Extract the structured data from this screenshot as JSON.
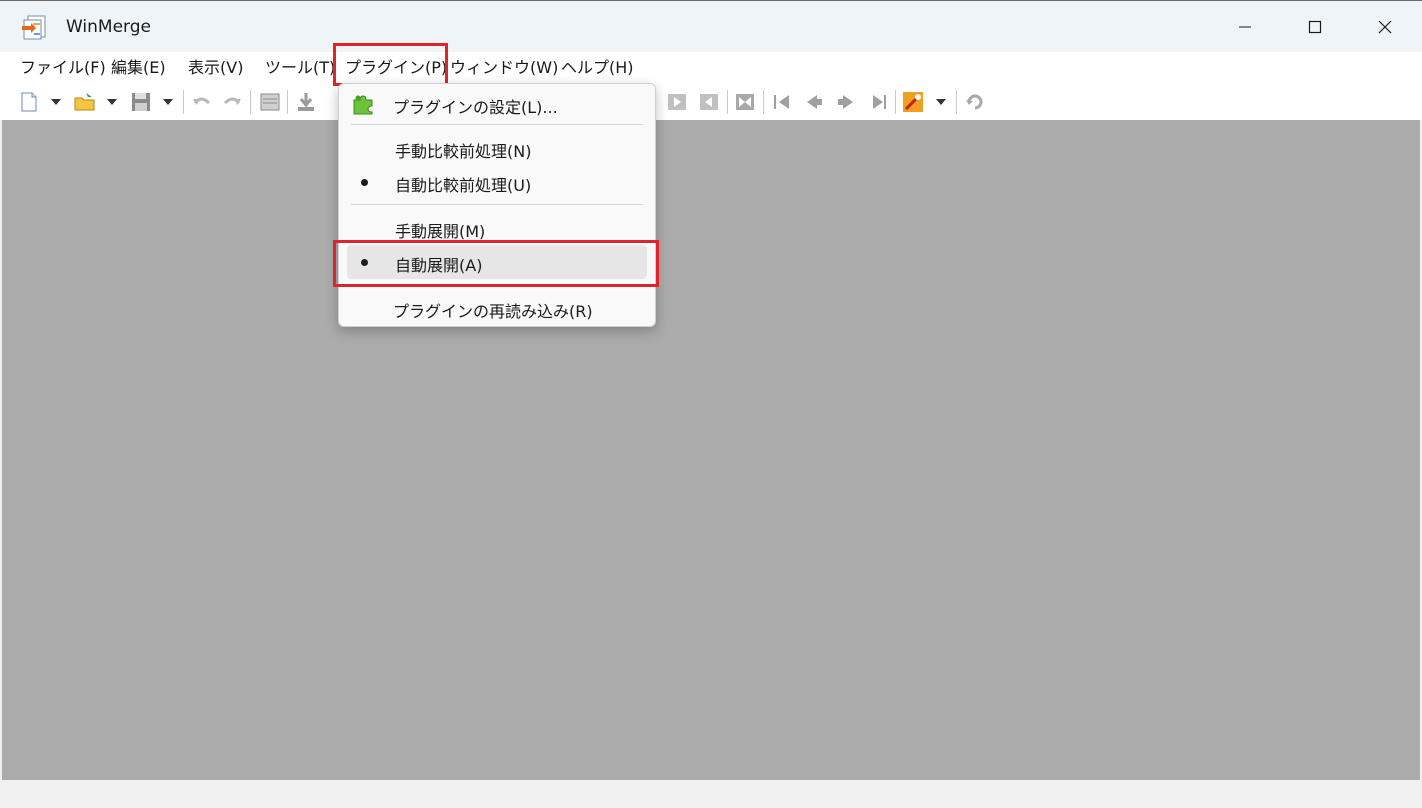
{
  "window": {
    "title": "WinMerge"
  },
  "menu": [
    {
      "label": "ファイル(F)"
    },
    {
      "label": "編集(E)"
    },
    {
      "label": "表示(V)"
    },
    {
      "label": "ツール(T)"
    },
    {
      "label": "プラグイン(P)"
    },
    {
      "label": "ウィンドウ(W)"
    },
    {
      "label": "ヘルプ(H)"
    }
  ],
  "plugin_menu": {
    "settings": "プラグインの設定(L)...",
    "manual_prediff": "手動比較前処理(N)",
    "auto_prediff": "自動比較前処理(U)",
    "manual_unpack": "手動展開(M)",
    "auto_unpack": "自動展開(A)",
    "reload": "プラグインの再読み込み(R)",
    "checked": [
      "auto_prediff",
      "auto_unpack"
    ]
  },
  "colors": {
    "highlight_border": "#e0242b",
    "client_bg": "#ababab",
    "titlebar_bg": "#eff4f9"
  }
}
